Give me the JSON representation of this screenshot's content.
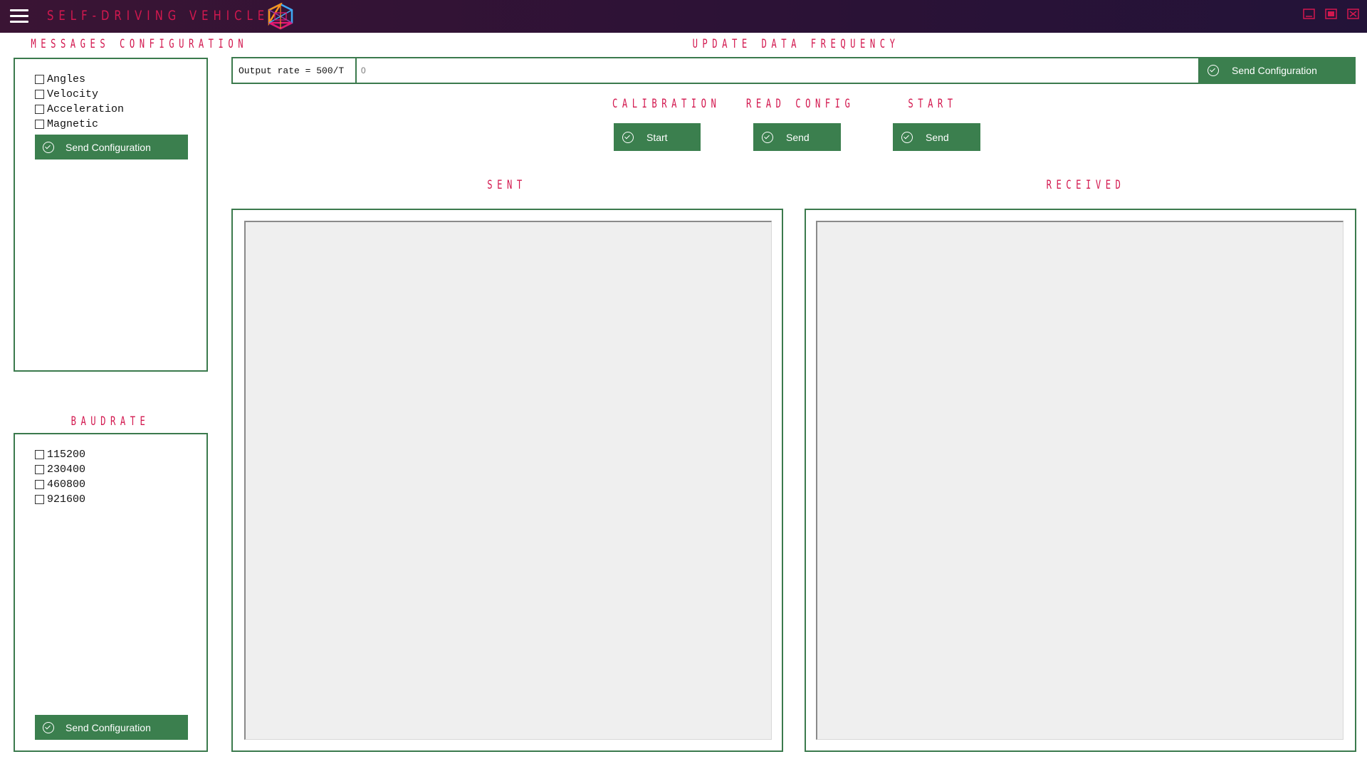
{
  "app": {
    "title": "SELF-DRIVING VEHICLE",
    "colors": {
      "accent_text": "#d3184f",
      "button_green": "#3b7f4e",
      "panel_border": "#3b7a4d",
      "titlebar_bg": "#2c1236"
    },
    "icons": {
      "menu": "hamburger-menu-icon",
      "logo": "hexagon-logo-icon",
      "minimize": "minimize-icon",
      "maximize": "maximize-icon",
      "close": "close-icon",
      "button_check": "check-circle-icon"
    }
  },
  "messages_config": {
    "heading": "MESSAGES CONFIGURATION",
    "options": [
      "Angles",
      "Velocity",
      "Acceleration",
      "Magnetic"
    ],
    "button_label": "Send Configuration"
  },
  "baudrate": {
    "heading": "BAUDRATE",
    "options": [
      "115200",
      "230400",
      "460800",
      "921600"
    ],
    "button_label": "Send Configuration"
  },
  "update_frequency": {
    "heading": "UPDATE DATA FREQUENCY",
    "rate_label": "Output rate = 500/T",
    "input_value": "0",
    "button_label": "Send Configuration"
  },
  "calibration": {
    "heading": "CALIBRATION",
    "button_label": "Start"
  },
  "read_config": {
    "heading": "READ CONFIG",
    "button_label": "Send"
  },
  "start": {
    "heading": "START",
    "button_label": "Send"
  },
  "sent": {
    "heading": "SENT",
    "content": ""
  },
  "received": {
    "heading": "RECEIVED",
    "content": ""
  }
}
